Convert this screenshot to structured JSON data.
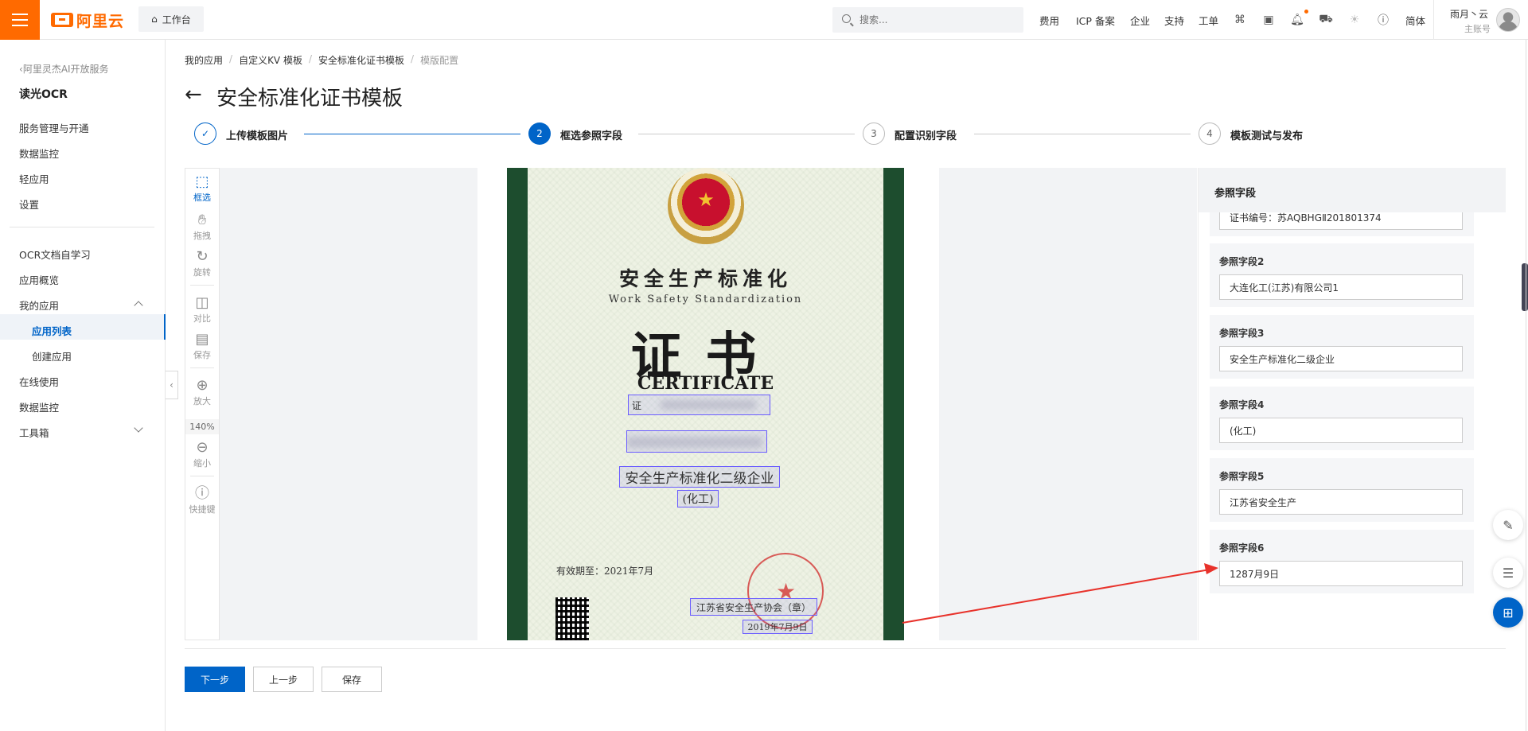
{
  "topbar": {
    "logo_text": "阿里云",
    "workbench": "工作台",
    "search_placeholder": "搜索...",
    "nav": [
      "费用",
      "ICP 备案",
      "企业",
      "支持",
      "工单"
    ],
    "lang": "简体",
    "user_name": "雨月丶云",
    "user_role": "主账号",
    "icons": [
      "cloud-shell-icon",
      "terminal-icon",
      "bell-icon",
      "cart-icon",
      "lightbulb-icon",
      "help-icon"
    ]
  },
  "sidebar": {
    "back_label": "阿里灵杰AI开放服务",
    "product": "读光OCR",
    "group1": [
      "服务管理与开通",
      "数据监控",
      "轻应用",
      "设置"
    ],
    "group2": [
      "OCR文档自学习",
      "应用概览",
      "我的应用"
    ],
    "sub_items": [
      "应用列表",
      "创建应用"
    ],
    "group3": [
      "在线使用",
      "数据监控",
      "工具箱"
    ]
  },
  "breadcrumb": [
    "我的应用",
    "自定义KV 模板",
    "安全标准化证书模板",
    "模版配置"
  ],
  "page_title": "安全标准化证书模板",
  "steps": [
    {
      "num": "",
      "label": "上传模板图片",
      "state": "done"
    },
    {
      "num": "2",
      "label": "框选参照字段",
      "state": "active"
    },
    {
      "num": "3",
      "label": "配置识别字段",
      "state": "todo"
    },
    {
      "num": "4",
      "label": "模板测试与发布",
      "state": "todo"
    }
  ],
  "tools": {
    "select": "框选",
    "drag": "拖拽",
    "rotate": "旋转",
    "compare": "对比",
    "save": "保存",
    "zoom_in": "放大",
    "zoom_level": "140%",
    "zoom_out": "缩小",
    "shortcuts": "快捷键"
  },
  "certificate": {
    "title_cn": "安全生产标准化",
    "title_en": "Work Safety Standardization",
    "big": "证书",
    "certificate": "CERTIFICATE",
    "no_prefix": "证",
    "grade": "安全生产标准化二级企业",
    "category": "(化工)",
    "valid": "有效期至：2021年7月",
    "issuer": "江苏省安全生产协会（章）",
    "date": "2019年7月9日"
  },
  "ref_panel": {
    "title": "参照字段",
    "cutoff_value": "证书编号：苏AQBHGⅡ201801374",
    "fields": [
      {
        "label": "参照字段2",
        "value": "大连化工(江苏)有限公司1"
      },
      {
        "label": "参照字段3",
        "value": "安全生产标准化二级企业"
      },
      {
        "label": "参照字段4",
        "value": "(化工)"
      },
      {
        "label": "参照字段5",
        "value": "江苏省安全生产"
      },
      {
        "label": "参照字段6",
        "value": "1287月9日"
      }
    ]
  },
  "buttons": {
    "next": "下一步",
    "prev": "上一步",
    "save": "保存"
  },
  "colors": {
    "brand": "#ff6a00",
    "primary": "#0064c8",
    "annotation": "#6a5cff",
    "arrow": "#e8322b"
  }
}
